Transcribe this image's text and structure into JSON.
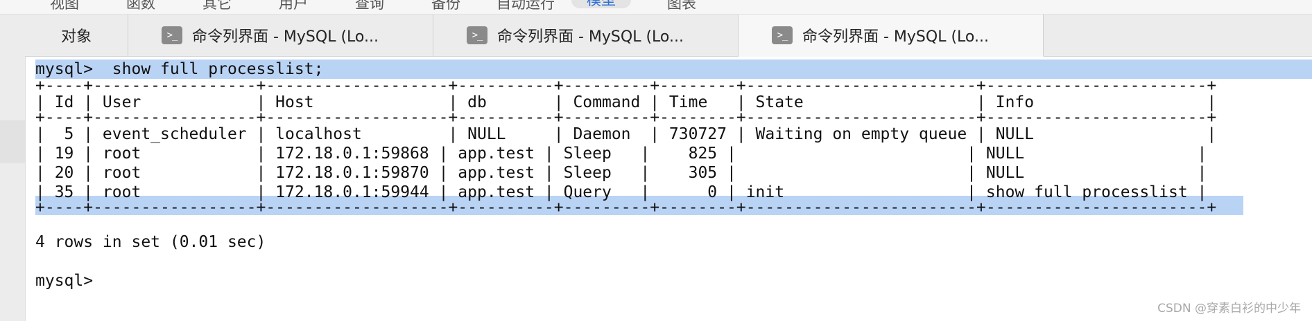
{
  "menubar": {
    "items": [
      "视图",
      "函数",
      "其它",
      "用户",
      "查询",
      "备份",
      "自动运行",
      "模型",
      "图表"
    ],
    "active_index": 7
  },
  "tabs": {
    "objects_label": "对象",
    "items": [
      {
        "icon": "terminal-icon",
        "glyph": ">_",
        "label": "命令列界面 - MySQL (Lo..."
      },
      {
        "icon": "terminal-icon",
        "glyph": ">_",
        "label": "命令列界面 - MySQL (Lo..."
      },
      {
        "icon": "terminal-icon",
        "glyph": ">_",
        "label": "命令列界面 - MySQL (Lo..."
      }
    ],
    "active_index": 2
  },
  "terminal": {
    "command_line": "mysql>  show full processlist;",
    "table_border": "+----+-----------------+-------------------+----------+---------+--------+------------------------+-----------------------+",
    "table_header": "| Id | User            | Host              | db       | Command | Time   | State                  | Info                  |",
    "rows": [
      "|  5 | event_scheduler | localhost         | NULL     | Daemon  | 730727 | Waiting on empty queue | NULL                  |",
      "| 19 | root            | 172.18.0.1:59868 | app.test | Sleep   |    825 |                        | NULL                  |",
      "| 20 | root            | 172.18.0.1:59870 | app.test | Sleep   |    305 |                        | NULL                  |",
      "| 35 | root            | 172.18.0.1:59944 | app.test | Query   |      0 | init                   | show full processlist |"
    ],
    "summary": "4 rows in set (0.01 sec)",
    "prompt": "mysql>"
  },
  "watermark": "CSDN @穿素白衫的中少年",
  "colors": {
    "selection": "#b9d3f5",
    "active_menu": "#2f6fd6"
  }
}
